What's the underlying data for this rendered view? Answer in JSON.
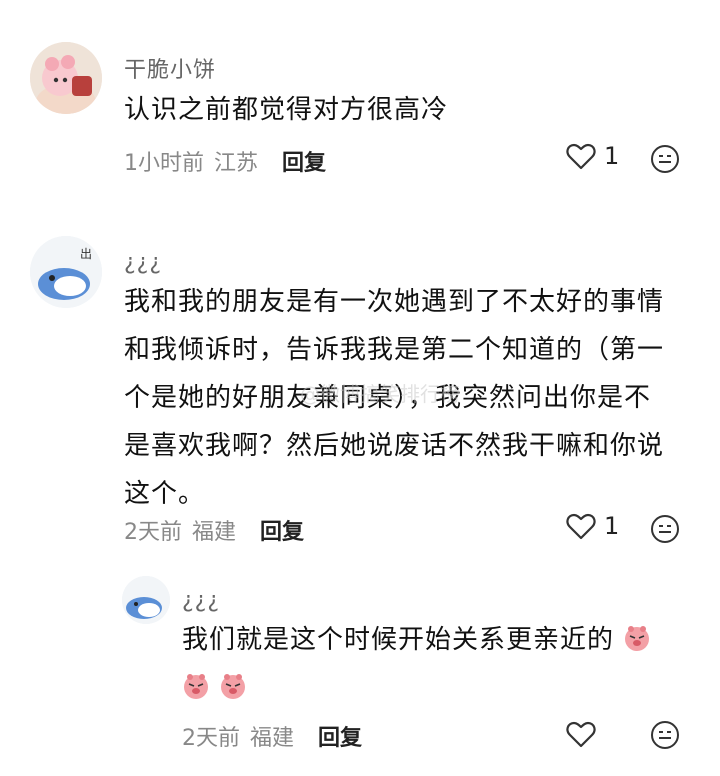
{
  "comments": [
    {
      "author": "干脆小饼",
      "text": "认识之前都觉得对方很高冷",
      "time": "1小时前",
      "location": "江苏",
      "reply_label": "回复",
      "likes": "1"
    },
    {
      "author": "¿¿¿",
      "text": "我和我的朋友是有一次她遇到了不太好的事情和我倾诉时，告诉我我是第二个知道的（第一个是她的好朋友兼同桌），我突然问出你是不是喜欢我啊？然后她说废话不然我干嘛和你说这个。",
      "time": "2天前",
      "location": "福建",
      "reply_label": "回复",
      "likes": "1"
    }
  ],
  "reply": {
    "author": "¿¿¿",
    "text": "我们就是这个时候开始关系更亲近的",
    "time": "2天前",
    "location": "福建",
    "reply_label": "回复"
  },
  "watermark": "@微博搞笑排行榜"
}
